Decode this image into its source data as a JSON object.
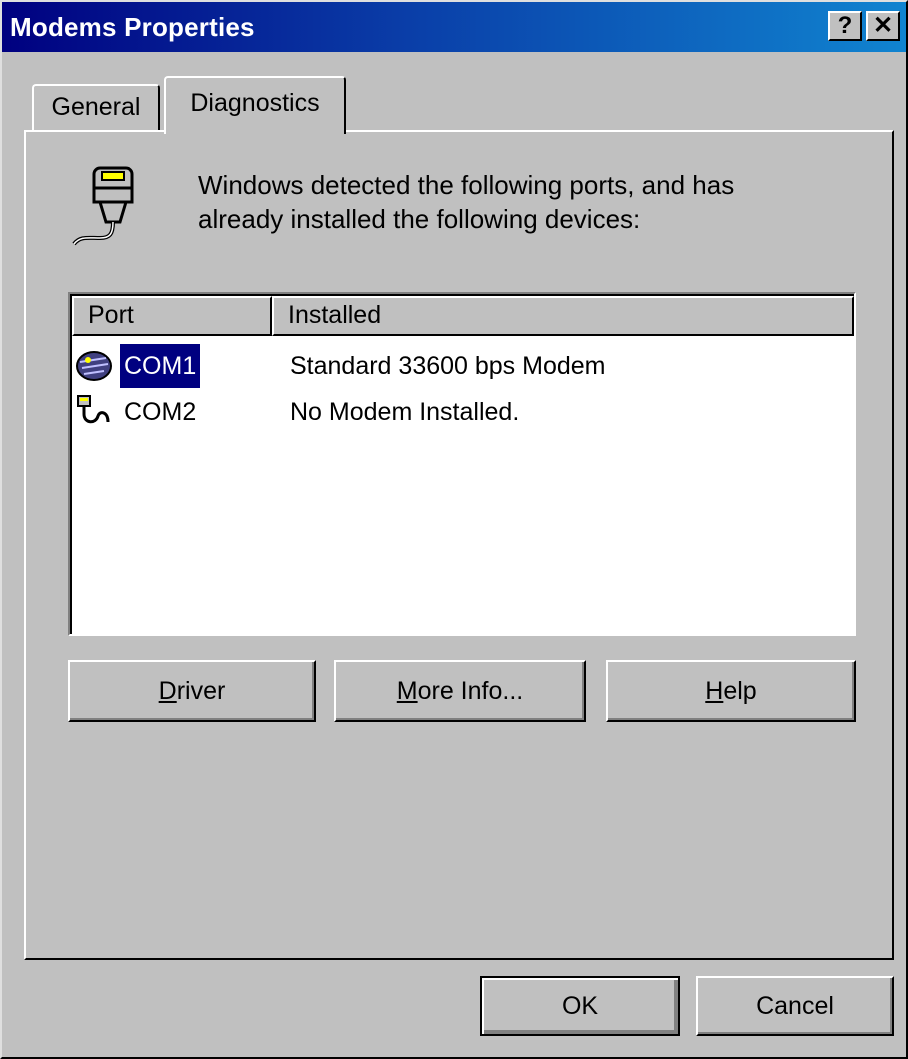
{
  "window": {
    "title": "Modems Properties"
  },
  "titlebar_buttons": {
    "help": "?",
    "close": "✕"
  },
  "tabs": [
    {
      "label": "General",
      "active": false
    },
    {
      "label": "Diagnostics",
      "active": true
    }
  ],
  "diagnostics": {
    "description_line1": "Windows detected the following ports, and has",
    "description_line2": "already installed the following devices:",
    "columns": {
      "port": "Port",
      "installed": "Installed"
    },
    "rows": [
      {
        "port": "COM1",
        "installed": "Standard 33600 bps Modem",
        "icon": "modem-icon",
        "selected": true
      },
      {
        "port": "COM2",
        "installed": "No Modem Installed.",
        "icon": "port-cable-icon",
        "selected": false
      }
    ],
    "buttons": {
      "driver_pre": "",
      "driver_key": "D",
      "driver_post": "river",
      "more_pre": "",
      "more_key": "M",
      "more_post": "ore Info...",
      "help_pre": "",
      "help_key": "H",
      "help_post": "elp"
    }
  },
  "footer": {
    "ok": "OK",
    "cancel": "Cancel"
  }
}
